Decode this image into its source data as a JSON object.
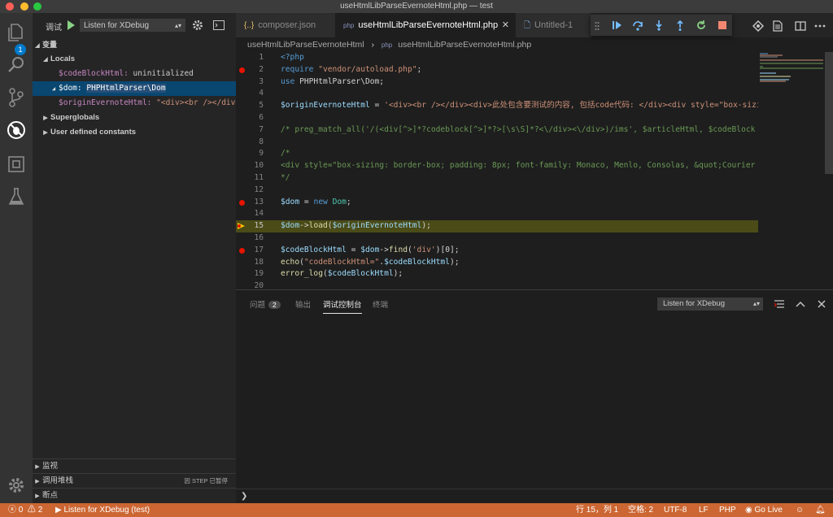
{
  "window": {
    "title": "useHtmlLibParseEvernoteHtml.php — test"
  },
  "activity_bar": {
    "explorer_badge": "1"
  },
  "debug_toolbar": {
    "label": "调试",
    "config": "Listen for XDebug"
  },
  "variables": {
    "section": "变量",
    "locals_label": "Locals",
    "items": [
      {
        "name": "$codeBlockHtml:",
        "value": "uninitialized"
      },
      {
        "name": "$dom:",
        "value": "PHPHtmlParser\\Dom"
      },
      {
        "name": "$originEvernoteHtml:",
        "value": "\"<div><br /></div>..."
      }
    ],
    "superglobals": "Superglobals",
    "constants": "User defined constants"
  },
  "sidebar_bottom": {
    "watch": "监视",
    "callstack": "调用堆栈",
    "callstack_status": "因 STEP 已暂停",
    "breakpoints": "断点"
  },
  "tabs": [
    {
      "label": "composer.json",
      "icon": "{..}"
    },
    {
      "label": "useHtmlLibParseEvernoteHtml.php",
      "icon": "php"
    },
    {
      "label": "Untitled-1",
      "icon": "file"
    }
  ],
  "breadcrumb": {
    "folder": "useHtmlLibParseEvernoteHtml",
    "file": "useHtmlLibParseEvernoteHtml.php"
  },
  "code_lines": [
    {
      "n": "1",
      "bp": "",
      "html": "<span class=\"k\">&lt;?php</span>"
    },
    {
      "n": "2",
      "bp": "bp",
      "html": "<span class=\"k\">require</span> <span class=\"s\">\"vendor/autoload.php\"</span><span class=\"p\">;</span>"
    },
    {
      "n": "3",
      "bp": "",
      "html": "<span class=\"k\">use</span> <span class=\"p\">PHPHtmlParser\\Dom;</span>"
    },
    {
      "n": "4",
      "bp": "",
      "html": ""
    },
    {
      "n": "5",
      "bp": "",
      "html": "<span class=\"v\">$originEvernoteHtml</span> <span class=\"p\">=</span> <span class=\"s\">'&lt;div&gt;&lt;br /&gt;&lt;/div&gt;&lt;div&gt;此处包含要测试的内容, 包括code代码: &lt;/div&gt;&lt;div style=\"box-sizing</span>"
    },
    {
      "n": "6",
      "bp": "",
      "html": ""
    },
    {
      "n": "7",
      "bp": "",
      "html": "<span class=\"c\">/* preg_match_all('/(&lt;div[^&gt;]*?codeblock[^&gt;]*?&gt;[\\s\\S]*?&lt;\\/div&gt;&lt;\\/div&gt;)/ims', $articleHtml, $codeBlock</span>"
    },
    {
      "n": "8",
      "bp": "",
      "html": ""
    },
    {
      "n": "9",
      "bp": "",
      "html": "<span class=\"c\">/*</span>"
    },
    {
      "n": "10",
      "bp": "",
      "html": "<span class=\"c\">&lt;div style=\"box-sizing: border-box; padding: 8px; font-family: Monaco, Menlo, Consolas, &amp;quot;Courier</span>"
    },
    {
      "n": "11",
      "bp": "",
      "html": "<span class=\"c\">*/</span>"
    },
    {
      "n": "12",
      "bp": "",
      "html": ""
    },
    {
      "n": "13",
      "bp": "bp",
      "html": "<span class=\"v\">$dom</span> <span class=\"p\">=</span> <span class=\"k\">new</span> <span class=\"t\">Dom</span><span class=\"p\">;</span>"
    },
    {
      "n": "14",
      "bp": "",
      "html": ""
    },
    {
      "n": "15",
      "bp": "current",
      "html": "<span class=\"v\">$dom</span><span class=\"p\">-&gt;</span><span class=\"f\">load</span><span class=\"p\">(</span><span class=\"v\">$originEvernoteHtml</span><span class=\"p\">);</span>"
    },
    {
      "n": "16",
      "bp": "",
      "html": ""
    },
    {
      "n": "17",
      "bp": "bp",
      "html": "<span class=\"v\">$codeBlockHtml</span> <span class=\"p\">=</span> <span class=\"v\">$dom</span><span class=\"p\">-&gt;</span><span class=\"f\">find</span><span class=\"p\">(</span><span class=\"s\">'div'</span><span class=\"p\">)[0];</span>"
    },
    {
      "n": "18",
      "bp": "",
      "html": "<span class=\"f\">echo</span><span class=\"p\">(</span><span class=\"s\">\"codeBlockHtml=\"</span><span class=\"p\">.</span><span class=\"v\">$codeBlockHtml</span><span class=\"p\">);</span>"
    },
    {
      "n": "19",
      "bp": "",
      "html": "<span class=\"f\">error_log</span><span class=\"p\">(</span><span class=\"v\">$codeBlockHtml</span><span class=\"p\">);</span>"
    },
    {
      "n": "20",
      "bp": "",
      "html": ""
    }
  ],
  "panel": {
    "tabs": [
      "问题",
      "输出",
      "调试控制台",
      "终端"
    ],
    "problems_count": "2",
    "config": "Listen for XDebug",
    "prompt": "❯"
  },
  "statusbar": {
    "errors": "0",
    "warnings": "2",
    "debug": "Listen for XDebug (test)",
    "position": "行 15，列 1",
    "spaces": "空格: 2",
    "encoding": "UTF-8",
    "eol": "LF",
    "language": "PHP",
    "golive": "Go Live"
  },
  "colors": {
    "accent": "#cc6633",
    "selection": "#094771",
    "current_line": "#4b4b18",
    "breakpoint": "#e51400"
  }
}
